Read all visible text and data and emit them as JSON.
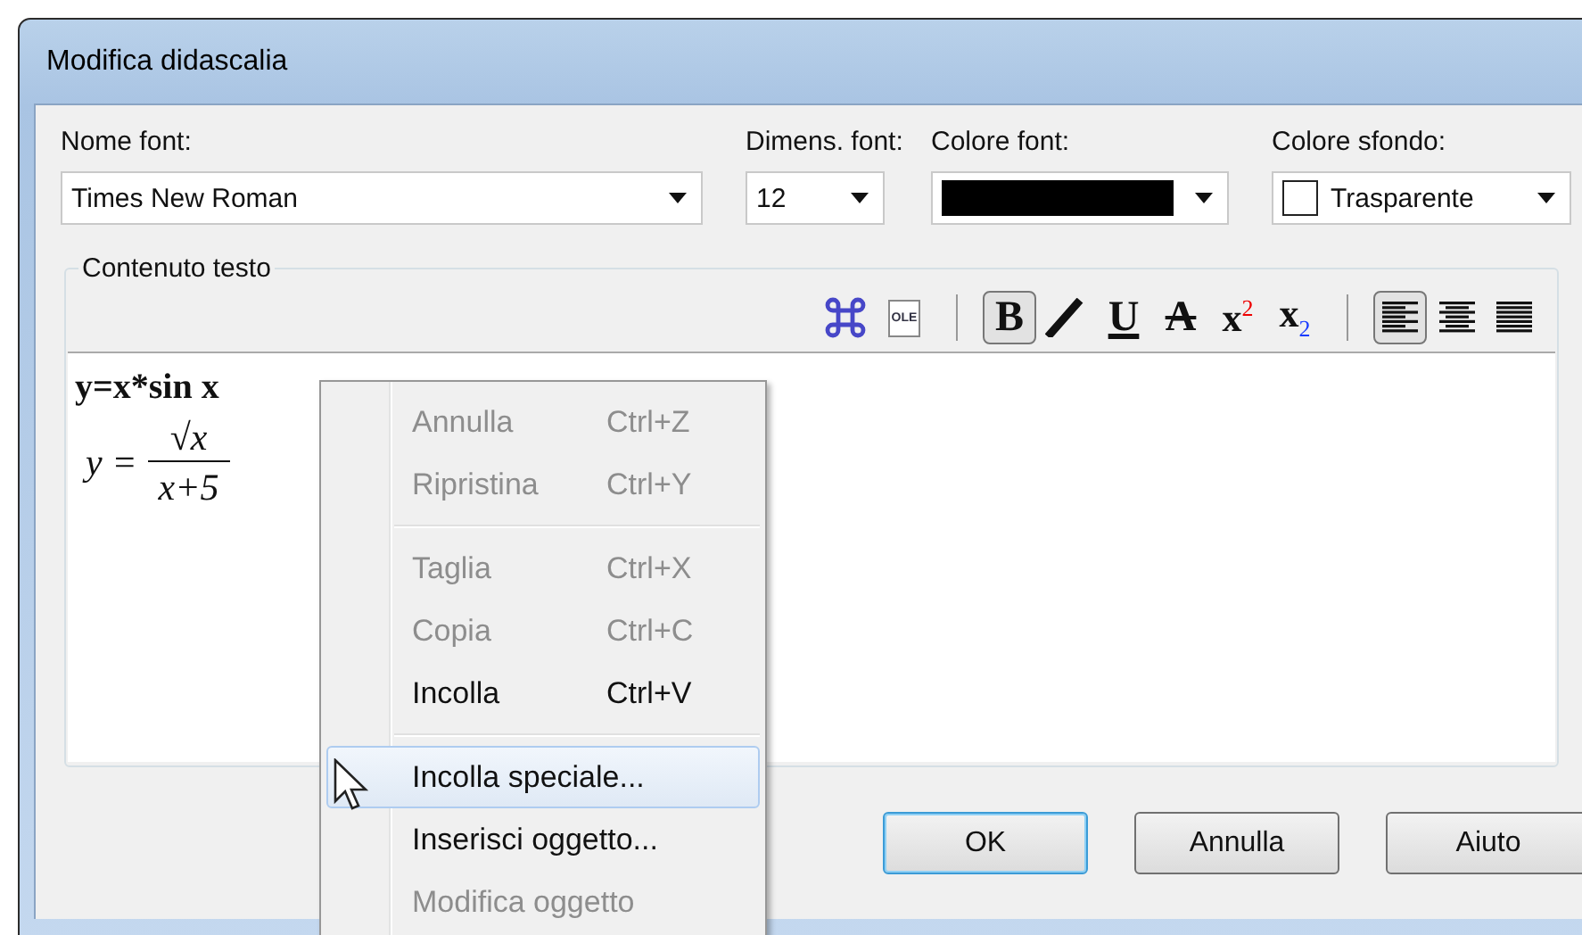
{
  "window": {
    "title": "Modifica didascalia"
  },
  "fields": [
    {
      "kind": "text",
      "label": "Nome font:",
      "value": "Times New Roman"
    },
    {
      "kind": "text",
      "label": "Dimens. font:",
      "value": "12"
    },
    {
      "kind": "swatch",
      "label": "Colore font:",
      "color": "#000000"
    },
    {
      "kind": "swatch_text",
      "label": "Colore sfondo:",
      "color": "#ffffff",
      "value": "Trasparente"
    }
  ],
  "group": {
    "title": "Contenuto testo"
  },
  "toolbar": [
    {
      "kind": "command",
      "pressed": false
    },
    {
      "kind": "ole",
      "label": "OLE",
      "pressed": false
    },
    {
      "kind": "separator"
    },
    {
      "kind": "bold",
      "glyph": "B",
      "pressed": true
    },
    {
      "kind": "italic",
      "pressed": false
    },
    {
      "kind": "underline",
      "glyph": "U",
      "pressed": false
    },
    {
      "kind": "strike",
      "glyph": "A",
      "pressed": false
    },
    {
      "kind": "superscript",
      "glyph": "x",
      "index": "2",
      "pressed": false
    },
    {
      "kind": "subscript",
      "glyph": "x",
      "index": "2",
      "pressed": false
    },
    {
      "kind": "separator"
    },
    {
      "kind": "align_left",
      "pressed": true
    },
    {
      "kind": "align_center",
      "pressed": false
    },
    {
      "kind": "align_right",
      "pressed": false
    }
  ],
  "editor": {
    "text": "y=x*sin x",
    "formula": {
      "lhs": "y =",
      "numerator": "√x",
      "denominator": "x+5"
    }
  },
  "context_menu": [
    {
      "kind": "item",
      "label": "Annulla",
      "shortcut": "Ctrl+Z",
      "disabled": true,
      "selected": false
    },
    {
      "kind": "item",
      "label": "Ripristina",
      "shortcut": "Ctrl+Y",
      "disabled": true,
      "selected": false
    },
    {
      "kind": "separator"
    },
    {
      "kind": "item",
      "label": "Taglia",
      "shortcut": "Ctrl+X",
      "disabled": true,
      "selected": false
    },
    {
      "kind": "item",
      "label": "Copia",
      "shortcut": "Ctrl+C",
      "disabled": true,
      "selected": false
    },
    {
      "kind": "item",
      "label": "Incolla",
      "shortcut": "Ctrl+V",
      "disabled": false,
      "selected": false
    },
    {
      "kind": "separator"
    },
    {
      "kind": "item",
      "label": "Incolla speciale...",
      "disabled": false,
      "selected": true
    },
    {
      "kind": "item",
      "label": "Inserisci oggetto...",
      "disabled": false,
      "selected": false
    },
    {
      "kind": "item",
      "label": "Modifica oggetto",
      "disabled": true,
      "selected": false
    }
  ],
  "buttons": [
    {
      "label": "OK",
      "default": true
    },
    {
      "label": "Annulla",
      "default": false
    },
    {
      "label": "Aiuto",
      "default": false
    }
  ]
}
